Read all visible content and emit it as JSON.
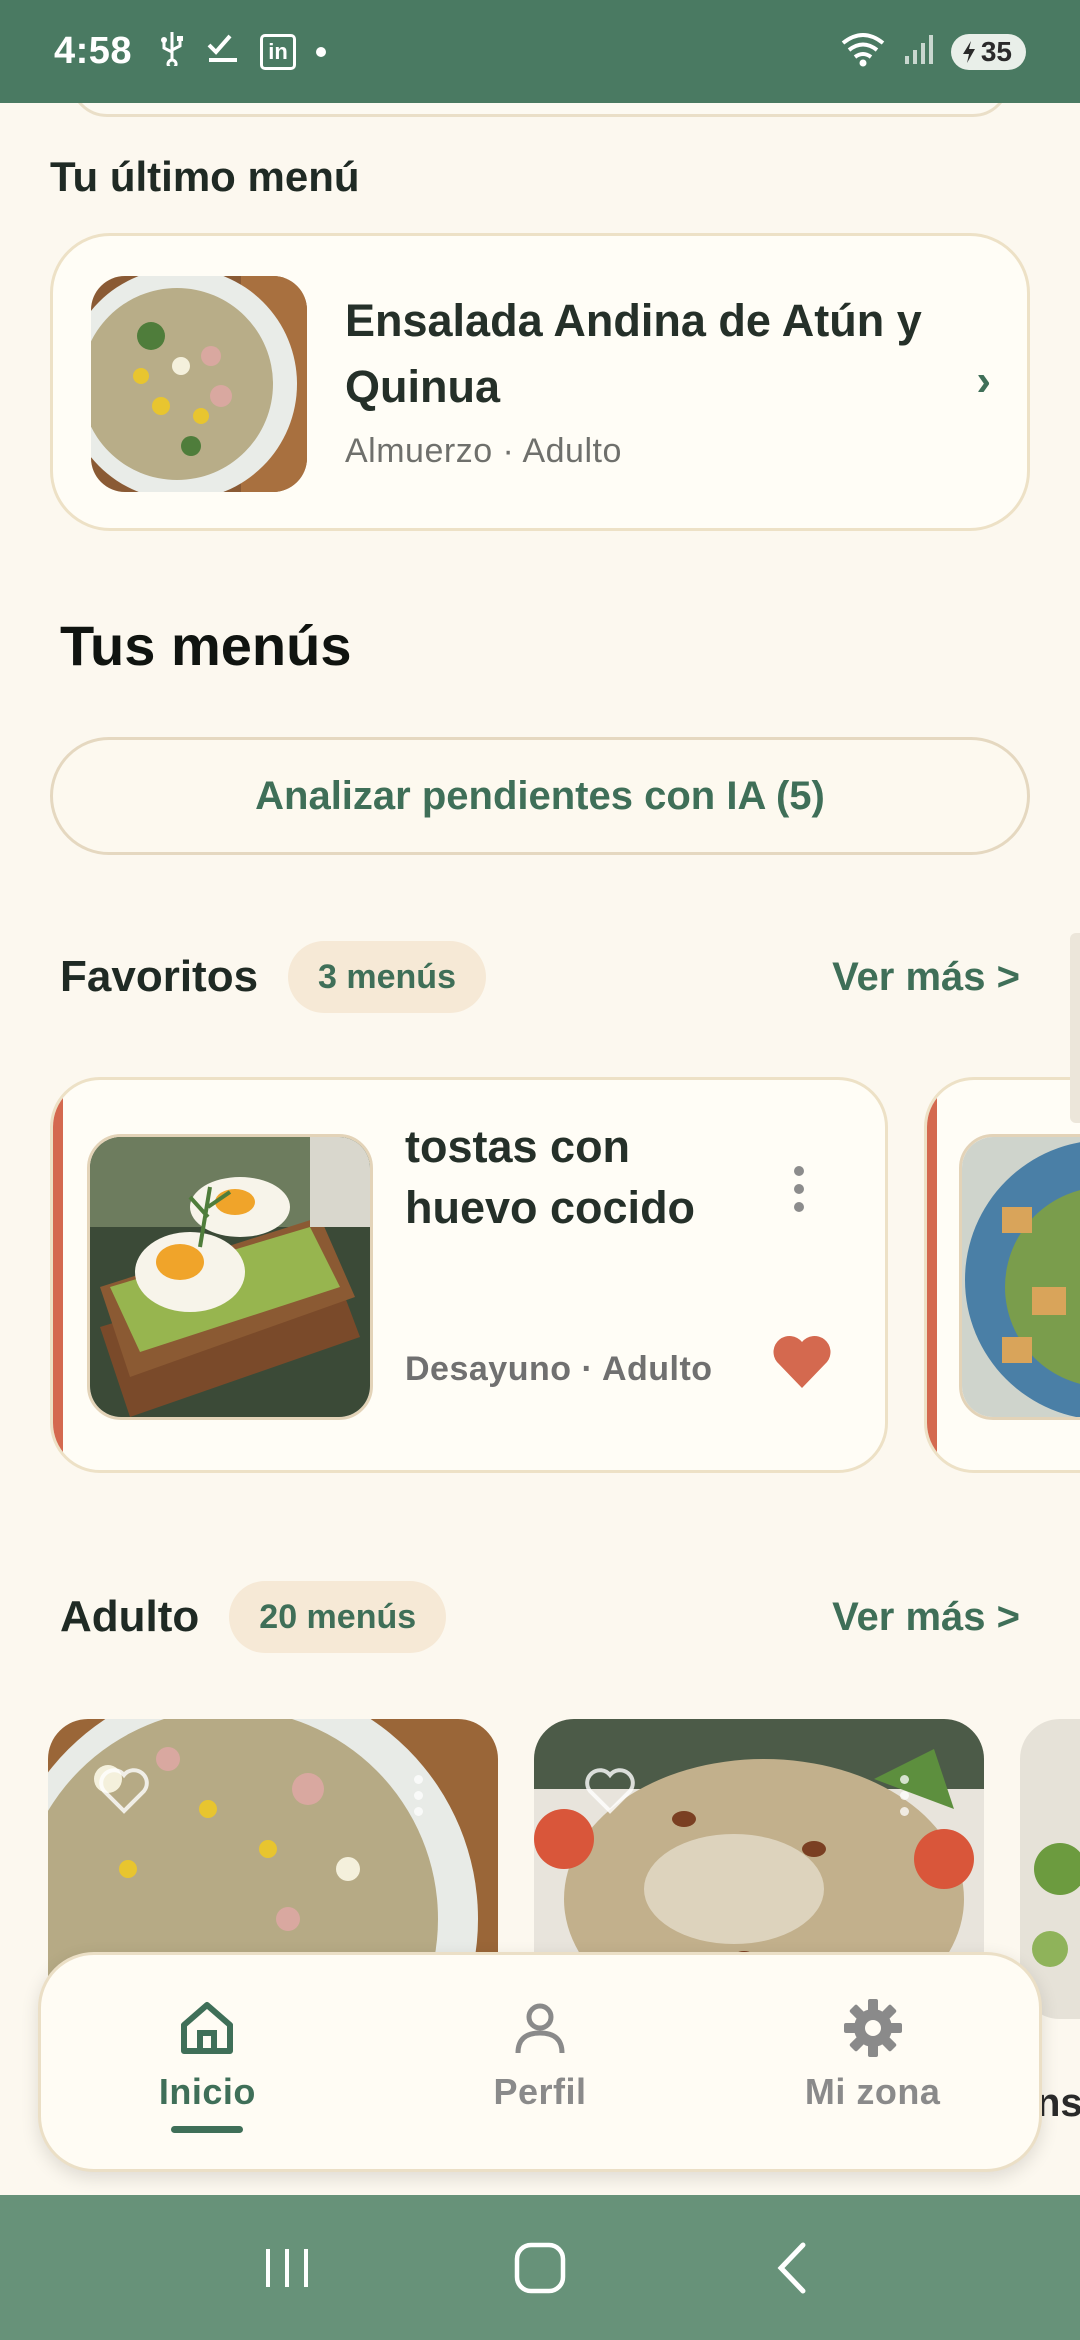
{
  "status": {
    "time": "4:58",
    "battery": "35"
  },
  "last_menu": {
    "heading": "Tu último menú",
    "title": "Ensalada Andina de Atún y Quinua",
    "meta": "Almuerzo · Adulto"
  },
  "menus": {
    "heading": "Tus menús",
    "analyze_button": "Analizar pendientes con IA (5)"
  },
  "favorites": {
    "title": "Favoritos",
    "count": "3 menús",
    "see_more": "Ver más >",
    "card": {
      "title": "tostas con huevo cocido",
      "meta": "Desayuno · Adulto"
    }
  },
  "adult": {
    "title": "Adulto",
    "count": "20 menús",
    "see_more": "Ver más >"
  },
  "partial": {
    "right_fragment": "ns"
  },
  "bottom_nav": {
    "items": [
      {
        "label": "Inicio"
      },
      {
        "label": "Perfil"
      },
      {
        "label": "Mi zona"
      }
    ]
  },
  "colors": {
    "brand_green": "#3f6f58",
    "status_bar": "#4a7a62",
    "heart": "#d4694f",
    "background": "#fcf8ef"
  }
}
